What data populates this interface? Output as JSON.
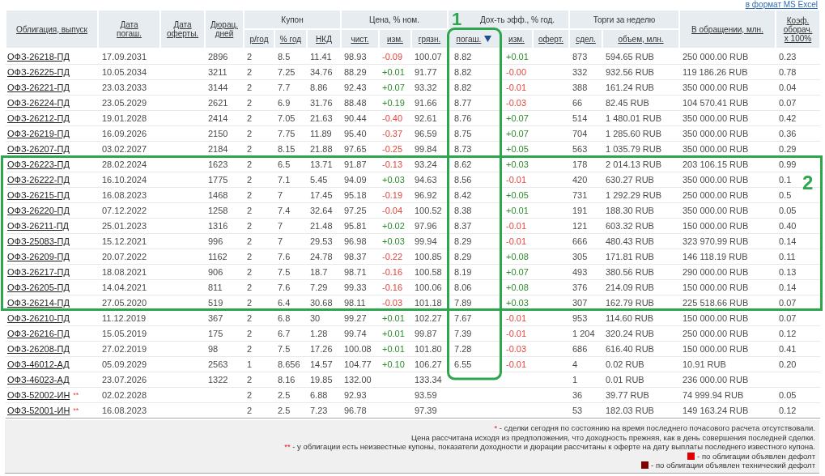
{
  "export_link": "в формат MS Excel",
  "table": {
    "header": [
      {
        "kind": "single",
        "label": "Облигация, выпуск",
        "sorted": false,
        "outlined": false
      },
      {
        "kind": "single",
        "label": "Дата погаш.",
        "sorted": false,
        "outlined": false
      },
      {
        "kind": "single",
        "label": "Дата оферты.",
        "sorted": false,
        "outlined": false
      },
      {
        "kind": "single",
        "label": "Дюрац. дней",
        "sorted": false,
        "outlined": false
      },
      {
        "kind": "group",
        "label": "Купон",
        "columns": [
          {
            "label": "р/год",
            "sorted": false,
            "outlined": false
          },
          {
            "label": "% год",
            "sorted": false,
            "outlined": false
          },
          {
            "label": "НКД",
            "sorted": false,
            "outlined": false
          }
        ]
      },
      {
        "kind": "group",
        "label": "Цена, % ном.",
        "columns": [
          {
            "label": "чист.",
            "sorted": false,
            "outlined": false
          },
          {
            "label": "изм.",
            "sorted": false,
            "outlined": false
          },
          {
            "label": "грязн.",
            "sorted": false,
            "outlined": false
          }
        ]
      },
      {
        "kind": "group",
        "label": "Дох-ть эфф., % год.",
        "columns": [
          {
            "label": "погаш.",
            "sorted": true,
            "outlined": true,
            "outline_label": "1"
          },
          {
            "label": "изм.",
            "sorted": false,
            "outlined": false
          },
          {
            "label": "оферт.",
            "sorted": false,
            "outlined": false
          }
        ]
      },
      {
        "kind": "group",
        "label": "Торги за неделю",
        "columns": [
          {
            "label": "сдел.",
            "sorted": false,
            "outlined": false
          },
          {
            "label": "объем, млн.",
            "sorted": false,
            "outlined": false
          }
        ]
      },
      {
        "kind": "single",
        "label": "В обращении, млн.",
        "sorted": false,
        "outlined": false
      },
      {
        "kind": "single",
        "label": "Коэф. оборач. x 100%",
        "sorted": false,
        "outlined": false
      }
    ],
    "sections": [
      {
        "outlined": false,
        "rows": [
          {
            "bond": "ОФЗ-26218-ПД",
            "maturity": "17.09.2031",
            "duration": "2896",
            "coupon_per_year": "2",
            "coupon_rate": "8.5",
            "accrued_interest": "11.41",
            "price_clean": "98.93",
            "price_change": {
              "text": "-0.09",
              "negative": true
            },
            "price_dirty": "100.07",
            "yield": "8.82",
            "yield_change": {
              "text": "+0.01",
              "negative": false
            },
            "deals": "873",
            "volume": "594.65 RUB",
            "outstanding": "250 000.00 RUB",
            "turnover": "0.23"
          },
          {
            "bond": "ОФЗ-26225-ПД",
            "maturity": "10.05.2034",
            "duration": "3211",
            "coupon_per_year": "2",
            "coupon_rate": "7.25",
            "accrued_interest": "34.76",
            "price_clean": "88.29",
            "price_change": {
              "text": "+0.01",
              "negative": false
            },
            "price_dirty": "91.77",
            "yield": "8.82",
            "yield_change": {
              "text": "-0.00",
              "negative": true
            },
            "deals": "332",
            "volume": "932.56 RUB",
            "outstanding": "119 186.26 RUB",
            "turnover": "0.78"
          },
          {
            "bond": "ОФЗ-26221-ПД",
            "maturity": "23.03.2033",
            "duration": "3144",
            "coupon_per_year": "2",
            "coupon_rate": "7.7",
            "accrued_interest": "8.86",
            "price_clean": "92.43",
            "price_change": {
              "text": "+0.07",
              "negative": false
            },
            "price_dirty": "93.32",
            "yield": "8.82",
            "yield_change": {
              "text": "-0.01",
              "negative": true
            },
            "deals": "388",
            "volume": "161.24 RUB",
            "outstanding": "350 000.00 RUB",
            "turnover": "0.04"
          },
          {
            "bond": "ОФЗ-26224-ПД",
            "maturity": "23.05.2029",
            "duration": "2621",
            "coupon_per_year": "2",
            "coupon_rate": "6.9",
            "accrued_interest": "31.76",
            "price_clean": "88.48",
            "price_change": {
              "text": "+0.19",
              "negative": false
            },
            "price_dirty": "91.66",
            "yield": "8.77",
            "yield_change": {
              "text": "-0.03",
              "negative": true
            },
            "deals": "66",
            "volume": "82.45 RUB",
            "outstanding": "104 570.41 RUB",
            "turnover": "0.07"
          },
          {
            "bond": "ОФЗ-26212-ПД",
            "maturity": "19.01.2028",
            "duration": "2414",
            "coupon_per_year": "2",
            "coupon_rate": "7.05",
            "accrued_interest": "21.63",
            "price_clean": "90.44",
            "price_change": {
              "text": "-0.40",
              "negative": true
            },
            "price_dirty": "92.61",
            "yield": "8.76",
            "yield_change": {
              "text": "+0.07",
              "negative": false
            },
            "deals": "514",
            "volume": "1 480.01 RUB",
            "outstanding": "350 000.00 RUB",
            "turnover": "0.42"
          },
          {
            "bond": "ОФЗ-26219-ПД",
            "maturity": "16.09.2026",
            "duration": "2150",
            "coupon_per_year": "2",
            "coupon_rate": "7.75",
            "accrued_interest": "11.89",
            "price_clean": "95.40",
            "price_change": {
              "text": "-0.37",
              "negative": true
            },
            "price_dirty": "96.59",
            "yield": "8.75",
            "yield_change": {
              "text": "+0.07",
              "negative": false
            },
            "deals": "704",
            "volume": "1 285.60 RUB",
            "outstanding": "350 000.00 RUB",
            "turnover": "0.36"
          },
          {
            "bond": "ОФЗ-26207-ПД",
            "maturity": "03.02.2027",
            "duration": "2184",
            "coupon_per_year": "2",
            "coupon_rate": "8.15",
            "accrued_interest": "21.88",
            "price_clean": "97.65",
            "price_change": {
              "text": "-0.25",
              "negative": true
            },
            "price_dirty": "99.84",
            "yield": "8.73",
            "yield_change": {
              "text": "+0.05",
              "negative": false
            },
            "deals": "563",
            "volume": "1 035.79 RUB",
            "outstanding": "350 000.00 RUB",
            "turnover": "0.29"
          }
        ]
      },
      {
        "outlined": true,
        "outline_label": "2",
        "rows": [
          {
            "bond": "ОФЗ-26223-ПД",
            "maturity": "28.02.2024",
            "duration": "1623",
            "coupon_per_year": "2",
            "coupon_rate": "6.5",
            "accrued_interest": "13.71",
            "price_clean": "91.87",
            "price_change": {
              "text": "-0.13",
              "negative": true
            },
            "price_dirty": "93.24",
            "yield": "8.62",
            "yield_change": {
              "text": "+0.03",
              "negative": false
            },
            "deals": "178",
            "volume": "2 014.13 RUB",
            "outstanding": "203 106.15 RUB",
            "turnover": "0.99"
          },
          {
            "bond": "ОФЗ-26222-ПД",
            "maturity": "16.10.2024",
            "duration": "1775",
            "coupon_per_year": "2",
            "coupon_rate": "7.1",
            "accrued_interest": "5.45",
            "price_clean": "94.09",
            "price_change": {
              "text": "+0.03",
              "negative": false
            },
            "price_dirty": "94.63",
            "yield": "8.56",
            "yield_change": {
              "text": "-0.01",
              "negative": true
            },
            "deals": "420",
            "volume": "630.27 RUB",
            "outstanding": "350 000.00 RUB",
            "turnover": "0.1"
          },
          {
            "bond": "ОФЗ-26215-ПД",
            "maturity": "16.08.2023",
            "duration": "1468",
            "coupon_per_year": "2",
            "coupon_rate": "7",
            "accrued_interest": "17.45",
            "price_clean": "95.18",
            "price_change": {
              "text": "-0.19",
              "negative": true
            },
            "price_dirty": "96.92",
            "yield": "8.42",
            "yield_change": {
              "text": "+0.05",
              "negative": false
            },
            "deals": "731",
            "volume": "1 292.29 RUB",
            "outstanding": "250 000.00 RUB",
            "turnover": "0.5"
          },
          {
            "bond": "ОФЗ-26220-ПД",
            "maturity": "07.12.2022",
            "duration": "1258",
            "coupon_per_year": "2",
            "coupon_rate": "7.4",
            "accrued_interest": "32.64",
            "price_clean": "97.25",
            "price_change": {
              "text": "-0.04",
              "negative": true
            },
            "price_dirty": "100.52",
            "yield": "8.38",
            "yield_change": {
              "text": "+0.01",
              "negative": false
            },
            "deals": "191",
            "volume": "188.30 RUB",
            "outstanding": "350 000.00 RUB",
            "turnover": "0.05"
          },
          {
            "bond": "ОФЗ-26211-ПД",
            "maturity": "25.01.2023",
            "duration": "1316",
            "coupon_per_year": "2",
            "coupon_rate": "7",
            "accrued_interest": "21.48",
            "price_clean": "95.81",
            "price_change": {
              "text": "+0.02",
              "negative": false
            },
            "price_dirty": "97.96",
            "yield": "8.37",
            "yield_change": {
              "text": "-0.01",
              "negative": true
            },
            "deals": "121",
            "volume": "603.32 RUB",
            "outstanding": "150 000.00 RUB",
            "turnover": "0.40"
          },
          {
            "bond": "ОФЗ-25083-ПД",
            "maturity": "15.12.2021",
            "duration": "996",
            "coupon_per_year": "2",
            "coupon_rate": "7",
            "accrued_interest": "29.53",
            "price_clean": "96.98",
            "price_change": {
              "text": "+0.03",
              "negative": false
            },
            "price_dirty": "99.94",
            "yield": "8.29",
            "yield_change": {
              "text": "-0.01",
              "negative": true
            },
            "deals": "666",
            "volume": "480.43 RUB",
            "outstanding": "323 970.99 RUB",
            "turnover": "0.14"
          },
          {
            "bond": "ОФЗ-26209-ПД",
            "maturity": "20.07.2022",
            "duration": "1162",
            "coupon_per_year": "2",
            "coupon_rate": "7.6",
            "accrued_interest": "24.78",
            "price_clean": "98.37",
            "price_change": {
              "text": "-0.22",
              "negative": true
            },
            "price_dirty": "100.85",
            "yield": "8.29",
            "yield_change": {
              "text": "+0.08",
              "negative": false
            },
            "deals": "305",
            "volume": "171.81 RUB",
            "outstanding": "146 118.19 RUB",
            "turnover": "0.11"
          },
          {
            "bond": "ОФЗ-26217-ПД",
            "maturity": "18.08.2021",
            "duration": "906",
            "coupon_per_year": "2",
            "coupon_rate": "7.5",
            "accrued_interest": "18.7",
            "price_clean": "98.71",
            "price_change": {
              "text": "-0.16",
              "negative": true
            },
            "price_dirty": "100.58",
            "yield": "8.19",
            "yield_change": {
              "text": "+0.07",
              "negative": false
            },
            "deals": "493",
            "volume": "380.56 RUB",
            "outstanding": "290 000.00 RUB",
            "turnover": "0.13"
          },
          {
            "bond": "ОФЗ-26205-ПД",
            "maturity": "14.04.2021",
            "duration": "811",
            "coupon_per_year": "2",
            "coupon_rate": "7.6",
            "accrued_interest": "7.29",
            "price_clean": "99.33",
            "price_change": {
              "text": "-0.16",
              "negative": true
            },
            "price_dirty": "100.06",
            "yield": "8.06",
            "yield_change": {
              "text": "+0.08",
              "negative": false
            },
            "deals": "376",
            "volume": "214.09 RUB",
            "outstanding": "150 000.00 RUB",
            "turnover": "0.14"
          },
          {
            "bond": "ОФЗ-26214-ПД",
            "maturity": "27.05.2020",
            "duration": "519",
            "coupon_per_year": "2",
            "coupon_rate": "6.4",
            "accrued_interest": "30.68",
            "price_clean": "98.11",
            "price_change": {
              "text": "-0.03",
              "negative": true
            },
            "price_dirty": "101.18",
            "yield": "7.89",
            "yield_change": {
              "text": "+0.03",
              "negative": false
            },
            "deals": "307",
            "volume": "162.79 RUB",
            "outstanding": "225 518.66 RUB",
            "turnover": "0.07"
          }
        ]
      },
      {
        "outlined": false,
        "rows": [
          {
            "bond": "ОФЗ-26210-ПД",
            "maturity": "11.12.2019",
            "duration": "367",
            "coupon_per_year": "2",
            "coupon_rate": "6.8",
            "accrued_interest": "30",
            "price_clean": "99.27",
            "price_change": {
              "text": "+0.01",
              "negative": false
            },
            "price_dirty": "102.27",
            "yield": "7.67",
            "yield_change": {
              "text": "-0.01",
              "negative": true
            },
            "deals": "953",
            "volume": "114.60 RUB",
            "outstanding": "150 000.00 RUB",
            "turnover": "0.07"
          },
          {
            "bond": "ОФЗ-26216-ПД",
            "maturity": "15.05.2019",
            "duration": "175",
            "coupon_per_year": "2",
            "coupon_rate": "6.7",
            "accrued_interest": "1.28",
            "price_clean": "99.74",
            "price_change": {
              "text": "+0.01",
              "negative": false
            },
            "price_dirty": "99.87",
            "yield": "7.39",
            "yield_change": {
              "text": "-0.01",
              "negative": true
            },
            "deals": "1 204",
            "volume": "320.24 RUB",
            "outstanding": "250 000.00 RUB",
            "turnover": "0.12"
          },
          {
            "bond": "ОФЗ-26208-ПД",
            "maturity": "27.02.2019",
            "duration": "98",
            "coupon_per_year": "2",
            "coupon_rate": "7.5",
            "accrued_interest": "17.26",
            "price_clean": "100.08",
            "price_change": {
              "text": "+0.01",
              "negative": false
            },
            "price_dirty": "101.80",
            "yield": "7.28",
            "yield_change": {
              "text": "-0.03",
              "negative": true
            },
            "deals": "686",
            "volume": "616.40 RUB",
            "outstanding": "150 000.00 RUB",
            "turnover": "0.41"
          },
          {
            "bond": "ОФЗ-46012-АД",
            "maturity": "05.09.2029",
            "duration": "2563",
            "coupon_per_year": "1",
            "coupon_rate": "8.656",
            "accrued_interest": "14.57",
            "price_clean": "104.77",
            "price_change": {
              "text": "+0.10",
              "negative": false
            },
            "price_dirty": "106.27",
            "yield": "6.55",
            "yield_change": {
              "text": "-0.01",
              "negative": true
            },
            "deals": "4",
            "volume": "0.02 RUB",
            "outstanding": "10.91 RUB",
            "turnover": "0.20"
          },
          {
            "bond": "ОФЗ-46023-АД",
            "maturity": "23.07.2026",
            "duration": "1322",
            "coupon_per_year": "2",
            "coupon_rate": "8.16",
            "accrued_interest": "19.85",
            "price_clean": "132.00",
            "price_dirty": "133.34",
            "deals": "1",
            "volume": "0.01 RUB",
            "outstanding": "236 000.00 RUB"
          },
          {
            "bond": "ОФЗ-52002-ИН",
            "note": "**",
            "maturity": "02.02.2028",
            "coupon_per_year": "2",
            "coupon_rate": "2.5",
            "accrued_interest": "6.88",
            "price_clean": "92.93",
            "price_dirty": "93.59",
            "deals": "36",
            "volume": "39.77 RUB",
            "outstanding": "74 999.94 RUB",
            "turnover": "0.05"
          },
          {
            "bond": "ОФЗ-52001-ИН",
            "note": "**",
            "maturity": "16.08.2023",
            "coupon_per_year": "2",
            "coupon_rate": "2.5",
            "accrued_interest": "7.23",
            "price_clean": "96.78",
            "price_dirty": "97.39",
            "deals": "53",
            "volume": "182.03 RUB",
            "outstanding": "149 163.24 RUB",
            "turnover": "0.12"
          }
        ]
      }
    ]
  },
  "footer": {
    "notes": [
      {
        "kind": "footnote",
        "mark": "*",
        "text": "- сделки сегодня по состоянию на время последнего почасового расчета отсутствовали."
      },
      {
        "kind": "plain",
        "text": "Цена рассчитана исходя из предположения, что доходность прежняя, как в день совершения последней сделки."
      },
      {
        "kind": "footnote",
        "mark": "**",
        "text": "- у облигации есть неизвестные купоны, показатели доходности и дюрации рассчитаны к оферте на дату выплаты последнего известного купона."
      },
      {
        "kind": "legend",
        "color": "#e00000",
        "text": "- по облигации объявлен дефолт"
      },
      {
        "kind": "legend",
        "color": "#800000",
        "text": "- по облигации объявлен технический дефолт"
      }
    ]
  }
}
